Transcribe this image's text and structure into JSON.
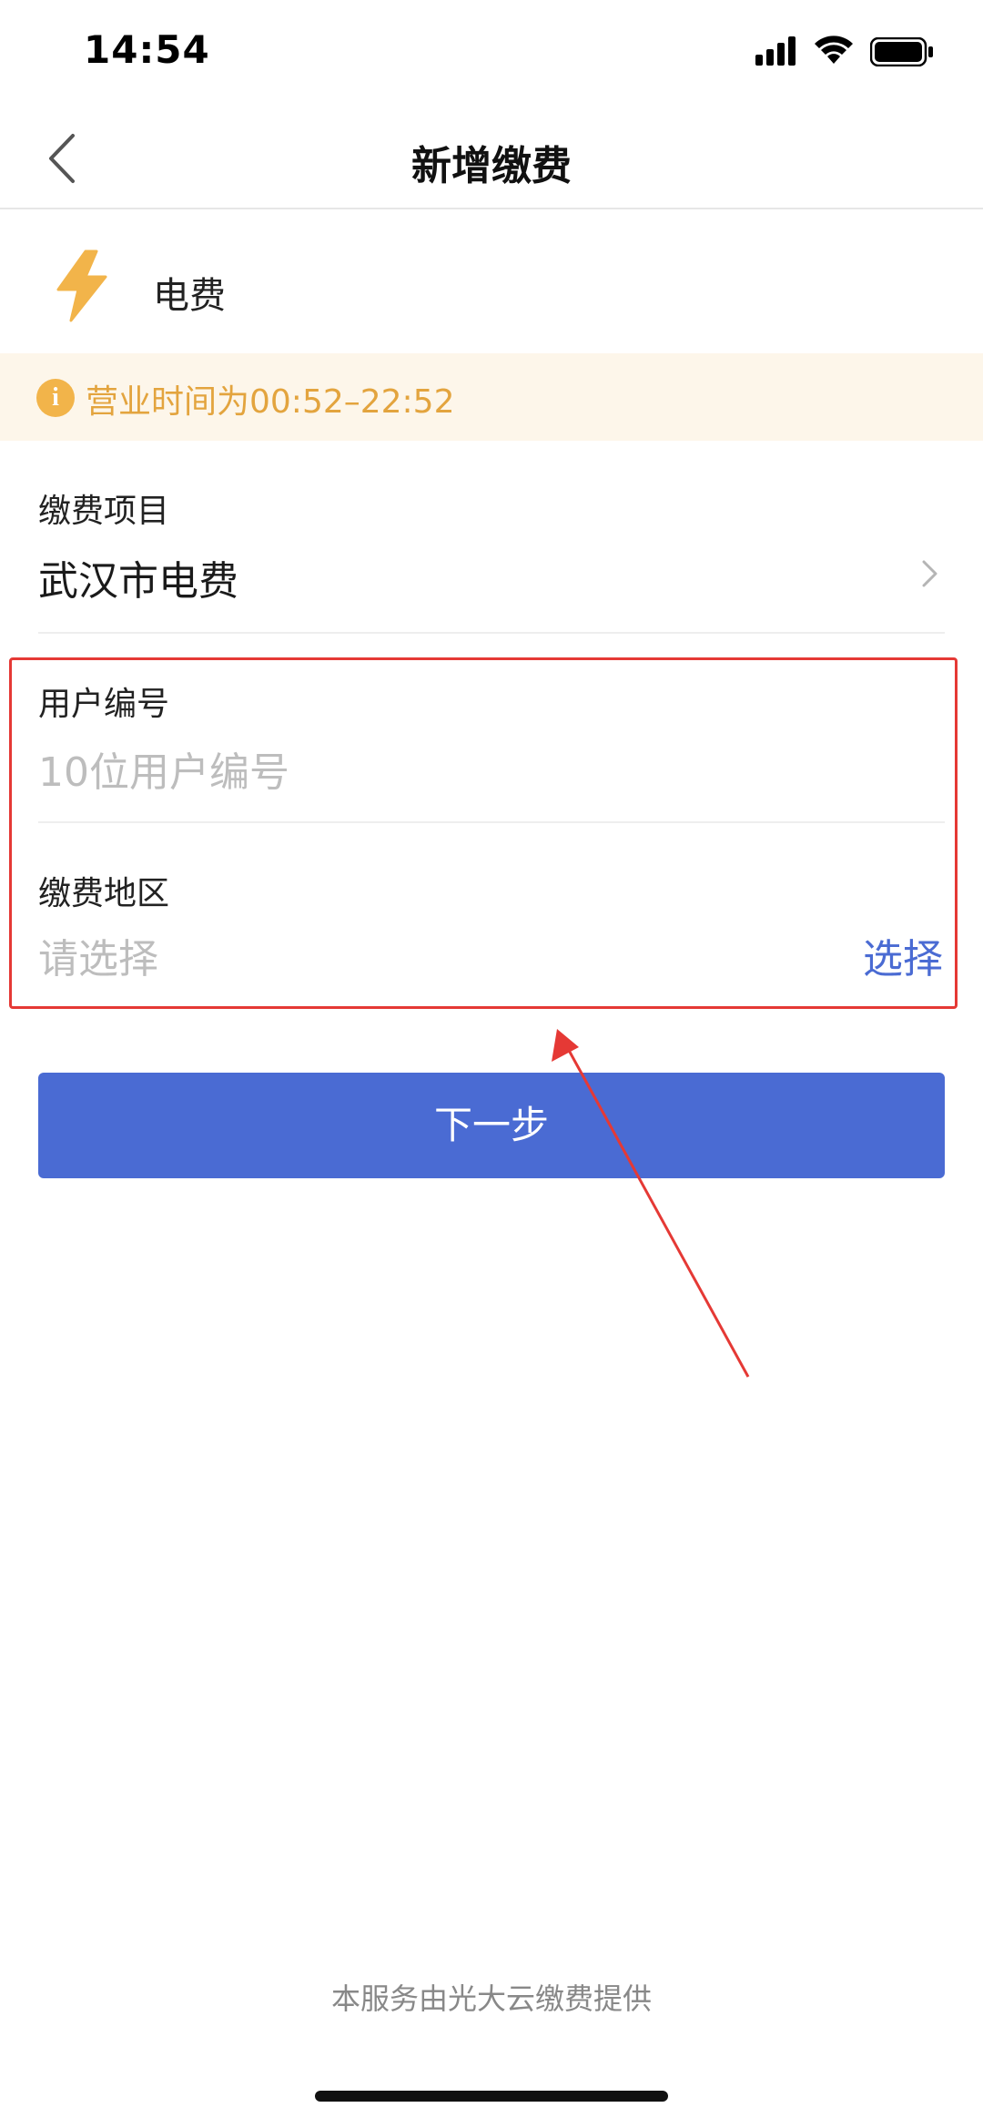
{
  "status_bar": {
    "time": "14:54"
  },
  "nav": {
    "title": "新增缴费"
  },
  "service": {
    "name": "电费",
    "icon": "lightning-bolt-icon",
    "icon_color": "#f2b44a"
  },
  "notice": {
    "text": "营业时间为00:52–22:52",
    "color": "#e3a43e"
  },
  "form": {
    "item": {
      "label": "缴费项目",
      "value": "武汉市电费"
    },
    "account": {
      "label": "用户编号",
      "placeholder": "10位用户编号"
    },
    "region": {
      "label": "缴费地区",
      "placeholder": "请选择",
      "action": "选择"
    }
  },
  "next_button": {
    "label": "下一步",
    "color": "#4a6bd3"
  },
  "footer": {
    "text": "本服务由光大云缴费提供"
  }
}
